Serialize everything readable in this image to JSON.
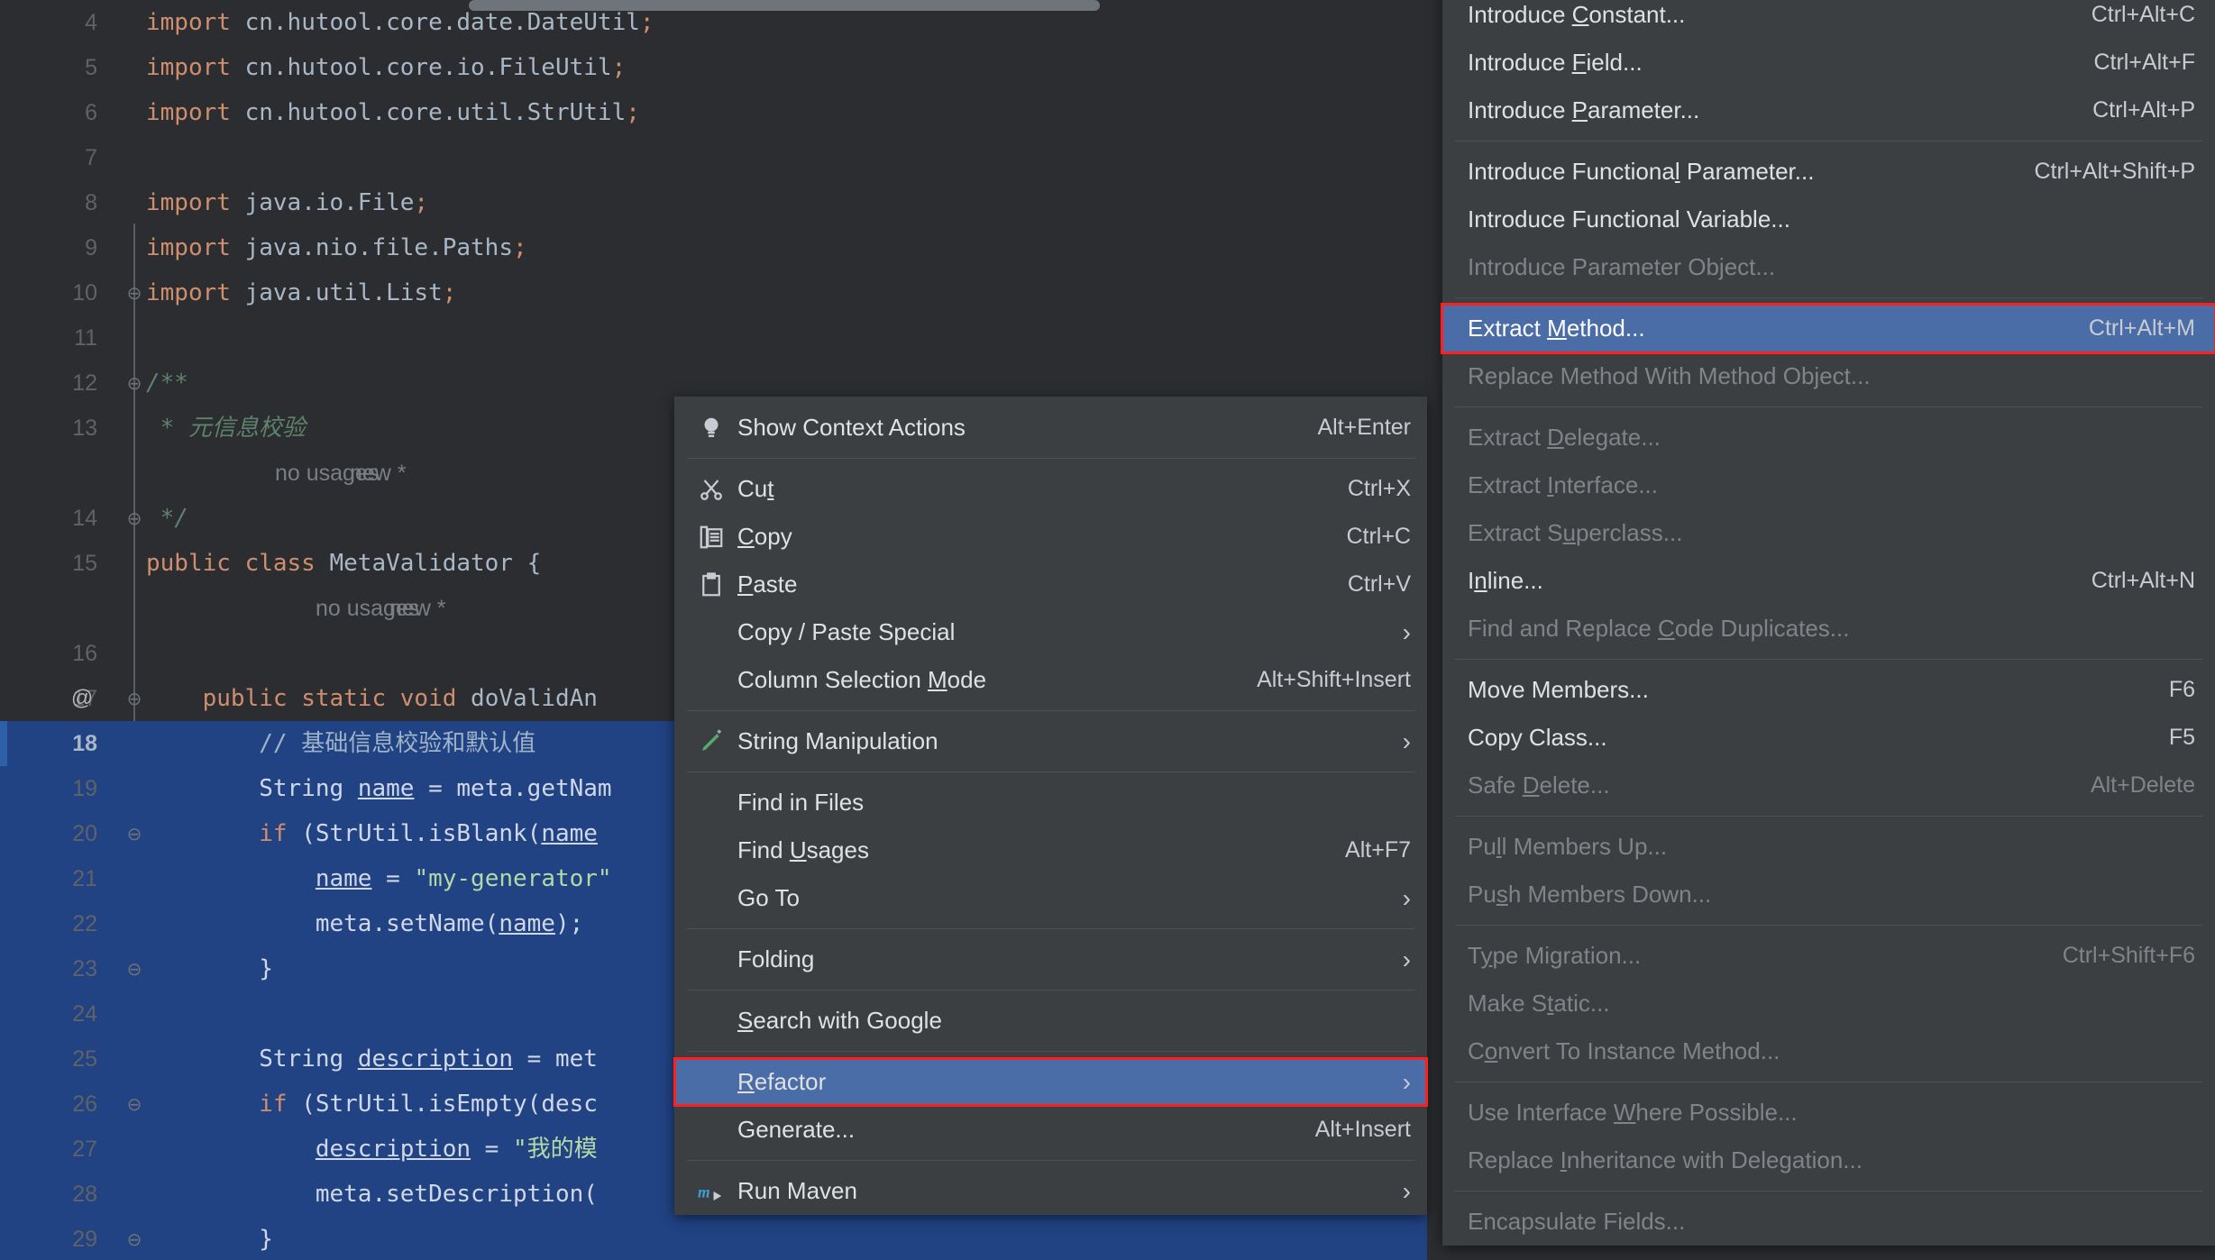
{
  "editor": {
    "lines": [
      {
        "num": "4",
        "indent": 0,
        "fold": "",
        "at": "",
        "selected": false,
        "tokens": [
          {
            "t": "import ",
            "c": "kw"
          },
          {
            "t": "cn.hutool.core.date.DateUtil",
            "c": "idn"
          },
          {
            "t": ";",
            "c": "pun"
          }
        ]
      },
      {
        "num": "5",
        "indent": 0,
        "fold": "",
        "at": "",
        "selected": false,
        "tokens": [
          {
            "t": "import ",
            "c": "kw"
          },
          {
            "t": "cn.hutool.core.io.FileUtil",
            "c": "idn"
          },
          {
            "t": ";",
            "c": "pun"
          }
        ]
      },
      {
        "num": "6",
        "indent": 0,
        "fold": "",
        "at": "",
        "selected": false,
        "tokens": [
          {
            "t": "import ",
            "c": "kw"
          },
          {
            "t": "cn.hutool.core.util.StrUtil",
            "c": "idn"
          },
          {
            "t": ";",
            "c": "pun"
          }
        ]
      },
      {
        "num": "7",
        "indent": 0,
        "fold": "",
        "at": "",
        "selected": false,
        "tokens": []
      },
      {
        "num": "8",
        "indent": 0,
        "fold": "",
        "at": "",
        "selected": false,
        "tokens": [
          {
            "t": "import ",
            "c": "kw"
          },
          {
            "t": "java.io.File",
            "c": "idn"
          },
          {
            "t": ";",
            "c": "pun"
          }
        ]
      },
      {
        "num": "9",
        "indent": 0,
        "fold": "",
        "at": "",
        "selected": false,
        "tokens": [
          {
            "t": "import ",
            "c": "kw"
          },
          {
            "t": "java.nio.file.Paths",
            "c": "idn"
          },
          {
            "t": ";",
            "c": "pun"
          }
        ]
      },
      {
        "num": "10",
        "indent": 0,
        "fold": "⊖",
        "at": "",
        "selected": false,
        "tokens": [
          {
            "t": "import ",
            "c": "kw"
          },
          {
            "t": "java.util.List",
            "c": "idn"
          },
          {
            "t": ";",
            "c": "pun"
          }
        ]
      },
      {
        "num": "11",
        "indent": 0,
        "fold": "",
        "at": "",
        "selected": false,
        "tokens": []
      },
      {
        "num": "12",
        "indent": 0,
        "fold": "⊖",
        "at": "",
        "selected": false,
        "tokens": [
          {
            "t": "/**",
            "c": "doc"
          }
        ]
      },
      {
        "num": "13",
        "indent": 0,
        "fold": "",
        "at": "",
        "selected": false,
        "tokens": [
          {
            "t": " * 元信息校验",
            "c": "doc"
          }
        ]
      },
      {
        "num": "14",
        "indent": 0,
        "fold": "⊖",
        "at": "",
        "selected": false,
        "tokens": [
          {
            "t": " */",
            "c": "doc"
          }
        ]
      },
      {
        "num": "15",
        "indent": 0,
        "fold": "",
        "at": "",
        "selected": false,
        "tokens": [
          {
            "t": "public class ",
            "c": "kw"
          },
          {
            "t": "MetaValidator",
            "c": "idn"
          },
          {
            "t": " {",
            "c": "idn"
          }
        ]
      },
      {
        "num": "16",
        "indent": 0,
        "fold": "",
        "at": "",
        "selected": false,
        "tokens": []
      },
      {
        "num": "17",
        "indent": 0,
        "fold": "⊖",
        "at": "@",
        "selected": false,
        "tokens": [
          {
            "t": "    ",
            "c": "idn"
          },
          {
            "t": "public static void ",
            "c": "kw"
          },
          {
            "t": "doValidAn",
            "c": "idn"
          }
        ]
      },
      {
        "num": "18",
        "indent": 0,
        "fold": "",
        "at": "",
        "selected": true,
        "current": true,
        "tokens": [
          {
            "t": "        ",
            "c": "idn"
          },
          {
            "t": "// 基础信息校验和默认值",
            "c": "cmt"
          }
        ]
      },
      {
        "num": "19",
        "indent": 0,
        "fold": "",
        "at": "",
        "selected": true,
        "tokens": [
          {
            "t": "        ",
            "c": "idn"
          },
          {
            "t": "String ",
            "c": "idn"
          },
          {
            "t": "name",
            "c": "lvar"
          },
          {
            "t": " = meta.getNam",
            "c": "idn"
          }
        ]
      },
      {
        "num": "20",
        "indent": 0,
        "fold": "⊖",
        "at": "",
        "selected": true,
        "tokens": [
          {
            "t": "        ",
            "c": "idn"
          },
          {
            "t": "if ",
            "c": "kw"
          },
          {
            "t": "(StrUtil.",
            "c": "idn"
          },
          {
            "t": "isBlank",
            "c": "idn"
          },
          {
            "t": "(",
            "c": "idn"
          },
          {
            "t": "name",
            "c": "lvar"
          }
        ]
      },
      {
        "num": "21",
        "indent": 0,
        "fold": "",
        "at": "",
        "selected": true,
        "tokens": [
          {
            "t": "            ",
            "c": "idn"
          },
          {
            "t": "name",
            "c": "lvar"
          },
          {
            "t": " = ",
            "c": "idn"
          },
          {
            "t": "\"my-generator\"",
            "c": "str"
          }
        ]
      },
      {
        "num": "22",
        "indent": 0,
        "fold": "",
        "at": "",
        "selected": true,
        "tokens": [
          {
            "t": "            meta.setName(",
            "c": "idn"
          },
          {
            "t": "name",
            "c": "lvar"
          },
          {
            "t": ");",
            "c": "idn"
          }
        ]
      },
      {
        "num": "23",
        "indent": 0,
        "fold": "⊖",
        "at": "",
        "selected": true,
        "tokens": [
          {
            "t": "        }",
            "c": "idn"
          }
        ]
      },
      {
        "num": "24",
        "indent": 0,
        "fold": "",
        "at": "",
        "selected": true,
        "tokens": []
      },
      {
        "num": "25",
        "indent": 0,
        "fold": "",
        "at": "",
        "selected": true,
        "tokens": [
          {
            "t": "        ",
            "c": "idn"
          },
          {
            "t": "String ",
            "c": "idn"
          },
          {
            "t": "description",
            "c": "lvar"
          },
          {
            "t": " = met",
            "c": "idn"
          }
        ]
      },
      {
        "num": "26",
        "indent": 0,
        "fold": "⊖",
        "at": "",
        "selected": true,
        "tokens": [
          {
            "t": "        ",
            "c": "idn"
          },
          {
            "t": "if ",
            "c": "kw"
          },
          {
            "t": "(StrUtil.",
            "c": "idn"
          },
          {
            "t": "isEmpty",
            "c": "idn"
          },
          {
            "t": "(desc",
            "c": "idn"
          }
        ]
      },
      {
        "num": "27",
        "indent": 0,
        "fold": "",
        "at": "",
        "selected": true,
        "tokens": [
          {
            "t": "            ",
            "c": "idn"
          },
          {
            "t": "description",
            "c": "lvar"
          },
          {
            "t": " = ",
            "c": "idn"
          },
          {
            "t": "\"我的模",
            "c": "str"
          }
        ]
      },
      {
        "num": "28",
        "indent": 0,
        "fold": "",
        "at": "",
        "selected": true,
        "tokens": [
          {
            "t": "            meta.setDescription(",
            "c": "idn"
          }
        ]
      },
      {
        "num": "29",
        "indent": 0,
        "fold": "⊖",
        "at": "",
        "selected": true,
        "tokens": [
          {
            "t": "        }",
            "c": "idn"
          }
        ]
      }
    ],
    "inlay_hints": [
      {
        "after_line": "14",
        "texts": [
          "no usages",
          "new *"
        ],
        "x": [
          145,
          228
        ]
      },
      {
        "after_line": "16",
        "texts": [
          "no usages",
          "new *"
        ],
        "x": [
          190,
          272
        ]
      }
    ]
  },
  "context_menu": {
    "items": [
      {
        "label": "Show Context Actions",
        "accel": "",
        "shortcut": "Alt+Enter",
        "icon": "lightbulb-icon",
        "arrow": false,
        "selected": false,
        "highlighted": false
      },
      {
        "sep": true
      },
      {
        "label": "Cut",
        "accel": "t",
        "shortcut": "Ctrl+X",
        "icon": "scissors-icon",
        "arrow": false,
        "selected": false,
        "highlighted": false
      },
      {
        "label": "Copy",
        "accel": "C",
        "shortcut": "Ctrl+C",
        "icon": "copy-icon",
        "arrow": false,
        "selected": false,
        "highlighted": false
      },
      {
        "label": "Paste",
        "accel": "P",
        "shortcut": "Ctrl+V",
        "icon": "clipboard-icon",
        "arrow": false,
        "selected": false,
        "highlighted": false
      },
      {
        "label": "Copy / Paste Special",
        "accel": "",
        "shortcut": "",
        "icon": "",
        "arrow": true,
        "selected": false,
        "highlighted": false
      },
      {
        "label": "Column Selection Mode",
        "accel": "M",
        "shortcut": "Alt+Shift+Insert",
        "icon": "",
        "arrow": false,
        "selected": false,
        "highlighted": false
      },
      {
        "sep": true
      },
      {
        "label": "String Manipulation",
        "accel": "",
        "shortcut": "",
        "icon": "pencil-icon",
        "arrow": true,
        "selected": false,
        "highlighted": false
      },
      {
        "sep": true
      },
      {
        "label": "Find in Files",
        "accel": "",
        "shortcut": "",
        "icon": "",
        "arrow": false,
        "selected": false,
        "highlighted": false
      },
      {
        "label": "Find Usages",
        "accel": "U",
        "shortcut": "Alt+F7",
        "icon": "",
        "arrow": false,
        "selected": false,
        "highlighted": false
      },
      {
        "label": "Go To",
        "accel": "",
        "shortcut": "",
        "icon": "",
        "arrow": true,
        "selected": false,
        "highlighted": false
      },
      {
        "sep": true
      },
      {
        "label": "Folding",
        "accel": "",
        "shortcut": "",
        "icon": "",
        "arrow": true,
        "selected": false,
        "highlighted": false
      },
      {
        "sep": true
      },
      {
        "label": "Search with Google",
        "accel": "S",
        "shortcut": "",
        "icon": "",
        "arrow": false,
        "selected": false,
        "highlighted": false
      },
      {
        "sep": true
      },
      {
        "label": "Refactor",
        "accel": "R",
        "shortcut": "",
        "icon": "",
        "arrow": true,
        "selected": true,
        "highlighted": true
      },
      {
        "label": "Generate...",
        "accel": "",
        "shortcut": "Alt+Insert",
        "icon": "",
        "arrow": false,
        "selected": false,
        "highlighted": false
      },
      {
        "sep": true
      },
      {
        "label": "Run Maven",
        "accel": "",
        "shortcut": "",
        "icon": "maven-icon",
        "arrow": true,
        "selected": false,
        "highlighted": false
      }
    ]
  },
  "refactor_submenu": {
    "items": [
      {
        "label": "Introduce Constant...",
        "accel": "C",
        "shortcut": "Ctrl+Alt+C",
        "disabled": false,
        "selected": false,
        "highlighted": false
      },
      {
        "label": "Introduce Field...",
        "accel": "F",
        "shortcut": "Ctrl+Alt+F",
        "disabled": false,
        "selected": false,
        "highlighted": false
      },
      {
        "label": "Introduce Parameter...",
        "accel": "P",
        "shortcut": "Ctrl+Alt+P",
        "disabled": false,
        "selected": false,
        "highlighted": false
      },
      {
        "sep": true
      },
      {
        "label": "Introduce Functional Parameter...",
        "accel": "l",
        "shortcut": "Ctrl+Alt+Shift+P",
        "disabled": false,
        "selected": false,
        "highlighted": false
      },
      {
        "label": "Introduce Functional Variable...",
        "accel": "",
        "shortcut": "",
        "disabled": false,
        "selected": false,
        "highlighted": false
      },
      {
        "label": "Introduce Parameter Object...",
        "accel": "",
        "shortcut": "",
        "disabled": true,
        "selected": false,
        "highlighted": false
      },
      {
        "sep": true
      },
      {
        "label": "Extract Method...",
        "accel": "M",
        "shortcut": "Ctrl+Alt+M",
        "disabled": false,
        "selected": true,
        "highlighted": true
      },
      {
        "label": "Replace Method With Method Object...",
        "accel": "",
        "shortcut": "",
        "disabled": true,
        "selected": false,
        "highlighted": false
      },
      {
        "sep": true
      },
      {
        "label": "Extract Delegate...",
        "accel": "D",
        "shortcut": "",
        "disabled": true,
        "selected": false,
        "highlighted": false
      },
      {
        "label": "Extract Interface...",
        "accel": "I",
        "shortcut": "",
        "disabled": true,
        "selected": false,
        "highlighted": false
      },
      {
        "label": "Extract Superclass...",
        "accel": "u",
        "shortcut": "",
        "disabled": true,
        "selected": false,
        "highlighted": false
      },
      {
        "label": "Inline...",
        "accel": "n",
        "shortcut": "Ctrl+Alt+N",
        "disabled": false,
        "selected": false,
        "highlighted": false
      },
      {
        "label": "Find and Replace Code Duplicates...",
        "accel": "C",
        "shortcut": "",
        "disabled": true,
        "selected": false,
        "highlighted": false
      },
      {
        "sep": true
      },
      {
        "label": "Move Members...",
        "accel": "",
        "shortcut": "F6",
        "disabled": false,
        "selected": false,
        "highlighted": false
      },
      {
        "label": "Copy Class...",
        "accel": "",
        "shortcut": "F5",
        "disabled": false,
        "selected": false,
        "highlighted": false
      },
      {
        "label": "Safe Delete...",
        "accel": "D",
        "shortcut": "Alt+Delete",
        "disabled": true,
        "selected": false,
        "highlighted": false
      },
      {
        "sep": true
      },
      {
        "label": "Pull Members Up...",
        "accel": "l",
        "shortcut": "",
        "disabled": true,
        "selected": false,
        "highlighted": false
      },
      {
        "label": "Push Members Down...",
        "accel": "s",
        "shortcut": "",
        "disabled": true,
        "selected": false,
        "highlighted": false
      },
      {
        "sep": true
      },
      {
        "label": "Type Migration...",
        "accel": "y",
        "shortcut": "Ctrl+Shift+F6",
        "disabled": true,
        "selected": false,
        "highlighted": false
      },
      {
        "label": "Make Static...",
        "accel": "t",
        "shortcut": "",
        "disabled": true,
        "selected": false,
        "highlighted": false
      },
      {
        "label": "Convert To Instance Method...",
        "accel": "o",
        "shortcut": "",
        "disabled": true,
        "selected": false,
        "highlighted": false
      },
      {
        "sep": true
      },
      {
        "label": "Use Interface Where Possible...",
        "accel": "W",
        "shortcut": "",
        "disabled": true,
        "selected": false,
        "highlighted": false
      },
      {
        "label": "Replace Inheritance with Delegation...",
        "accel": "I",
        "shortcut": "",
        "disabled": true,
        "selected": false,
        "highlighted": false
      },
      {
        "sep": true
      },
      {
        "label": "Encapsulate Fields...",
        "accel": "",
        "shortcut": "",
        "disabled": true,
        "selected": false,
        "highlighted": false
      }
    ]
  },
  "colors": {
    "menu_bg": "#3c3f41",
    "menu_selected": "#4a6da7",
    "highlight_outline": "#ff1f1f",
    "editor_bg": "#2b2d30",
    "selection_bg": "#214283",
    "keyword": "#cf8e6d",
    "string": "#6aab73",
    "comment": "#5f826b"
  }
}
